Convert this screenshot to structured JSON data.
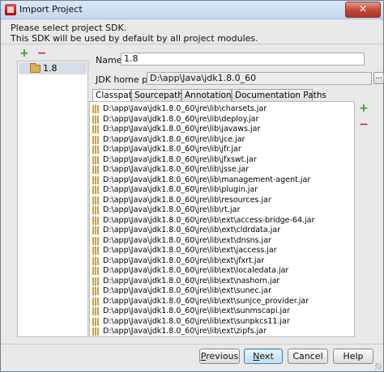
{
  "window": {
    "title": "Import Project",
    "close_glyph": "✕"
  },
  "description": {
    "line1": "Please select project SDK.",
    "line2": "This SDK will be used by default by all project modules."
  },
  "sdk_panel": {
    "add_glyph": "+",
    "remove_glyph": "−",
    "items": [
      {
        "label": "1.8",
        "icon": "folder-icon",
        "selected": true
      }
    ]
  },
  "form": {
    "name_label": "Name:",
    "name_value": "1.8",
    "jdk_home_label": "JDK home path:",
    "jdk_home_value": "D:\\app\\Java\\jdk1.8.0_60",
    "browse_label": "..."
  },
  "tabs": [
    {
      "label": "Classpath",
      "active": true
    },
    {
      "label": "Sourcepath",
      "active": false
    },
    {
      "label": "Annotations",
      "active": false
    },
    {
      "label": "Documentation Paths",
      "active": false
    }
  ],
  "classpath": {
    "add_glyph": "+",
    "remove_glyph": "−",
    "entries": [
      "D:\\app\\Java\\jdk1.8.0_60\\jre\\lib\\charsets.jar",
      "D:\\app\\Java\\jdk1.8.0_60\\jre\\lib\\deploy.jar",
      "D:\\app\\Java\\jdk1.8.0_60\\jre\\lib\\javaws.jar",
      "D:\\app\\Java\\jdk1.8.0_60\\jre\\lib\\jce.jar",
      "D:\\app\\Java\\jdk1.8.0_60\\jre\\lib\\jfr.jar",
      "D:\\app\\Java\\jdk1.8.0_60\\jre\\lib\\jfxswt.jar",
      "D:\\app\\Java\\jdk1.8.0_60\\jre\\lib\\jsse.jar",
      "D:\\app\\Java\\jdk1.8.0_60\\jre\\lib\\management-agent.jar",
      "D:\\app\\Java\\jdk1.8.0_60\\jre\\lib\\plugin.jar",
      "D:\\app\\Java\\jdk1.8.0_60\\jre\\lib\\resources.jar",
      "D:\\app\\Java\\jdk1.8.0_60\\jre\\lib\\rt.jar",
      "D:\\app\\Java\\jdk1.8.0_60\\jre\\lib\\ext\\access-bridge-64.jar",
      "D:\\app\\Java\\jdk1.8.0_60\\jre\\lib\\ext\\cldrdata.jar",
      "D:\\app\\Java\\jdk1.8.0_60\\jre\\lib\\ext\\dnsns.jar",
      "D:\\app\\Java\\jdk1.8.0_60\\jre\\lib\\ext\\jaccess.jar",
      "D:\\app\\Java\\jdk1.8.0_60\\jre\\lib\\ext\\jfxrt.jar",
      "D:\\app\\Java\\jdk1.8.0_60\\jre\\lib\\ext\\localedata.jar",
      "D:\\app\\Java\\jdk1.8.0_60\\jre\\lib\\ext\\nashorn.jar",
      "D:\\app\\Java\\jdk1.8.0_60\\jre\\lib\\ext\\sunec.jar",
      "D:\\app\\Java\\jdk1.8.0_60\\jre\\lib\\ext\\sunjce_provider.jar",
      "D:\\app\\Java\\jdk1.8.0_60\\jre\\lib\\ext\\sunmscapi.jar",
      "D:\\app\\Java\\jdk1.8.0_60\\jre\\lib\\ext\\sunpkcs11.jar",
      "D:\\app\\Java\\jdk1.8.0_60\\jre\\lib\\ext\\zipfs.jar"
    ]
  },
  "buttons": {
    "previous_mnemonic": "P",
    "previous_rest": "revious",
    "next_mnemonic": "N",
    "next_rest": "ext",
    "cancel": "Cancel",
    "help": "Help"
  },
  "colors": {
    "add": "#2f9d2f",
    "remove": "#c42a2a",
    "selection": "#d6dde7",
    "default_button": "#bfdcf3"
  }
}
